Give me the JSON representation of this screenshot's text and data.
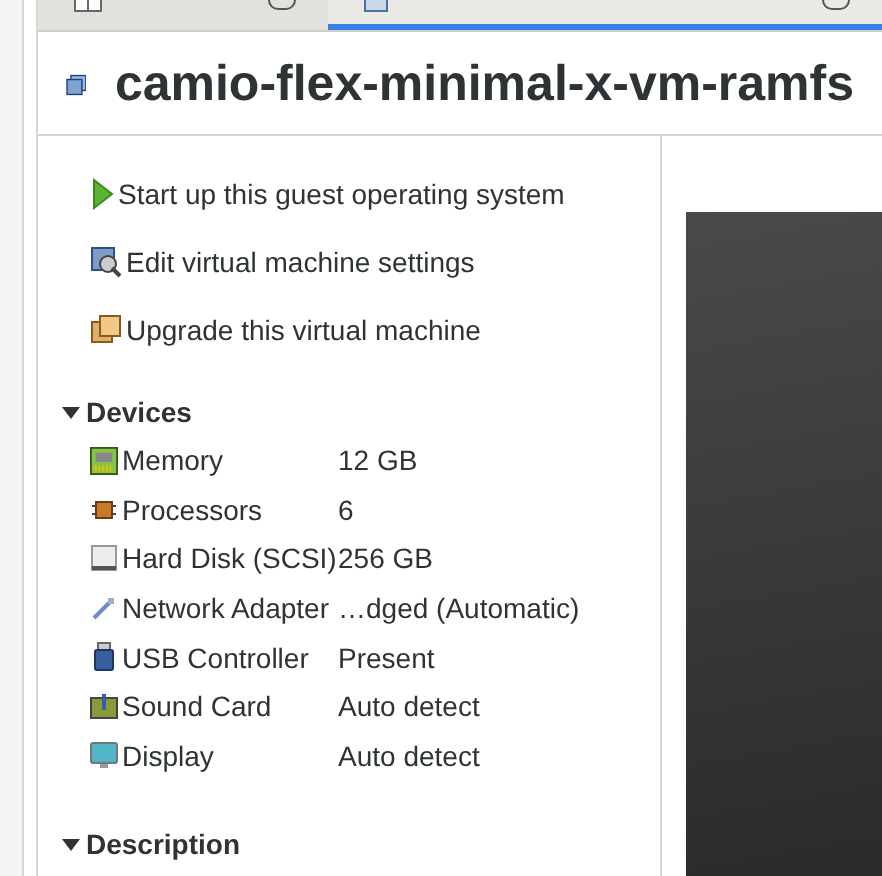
{
  "tabs": [
    {
      "kind": "library",
      "selected": false
    },
    {
      "kind": "vm",
      "selected": true
    }
  ],
  "vm": {
    "title": "camio-flex-minimal-x-vm-ramfs"
  },
  "actions": [
    {
      "kind": "start",
      "label": "Start up this guest operating system"
    },
    {
      "kind": "edit",
      "label": "Edit virtual machine settings"
    },
    {
      "kind": "upgrade",
      "label": "Upgrade this virtual machine"
    }
  ],
  "devices": {
    "heading": "Devices",
    "expanded": true,
    "items": [
      {
        "kind": "memory",
        "name": "Memory",
        "value": "12 GB"
      },
      {
        "kind": "cpu",
        "name": "Processors",
        "value": "6"
      },
      {
        "kind": "disk",
        "name": "Hard Disk (SCSI)",
        "value": "256 GB"
      },
      {
        "kind": "network",
        "name": "Network Adapter",
        "value": "…dged (Automatic)"
      },
      {
        "kind": "usb",
        "name": "USB Controller",
        "value": "Present"
      },
      {
        "kind": "sound",
        "name": "Sound Card",
        "value": "Auto detect"
      },
      {
        "kind": "display",
        "name": "Display",
        "value": "Auto detect"
      }
    ]
  },
  "description": {
    "heading": "Description",
    "expanded": true
  }
}
